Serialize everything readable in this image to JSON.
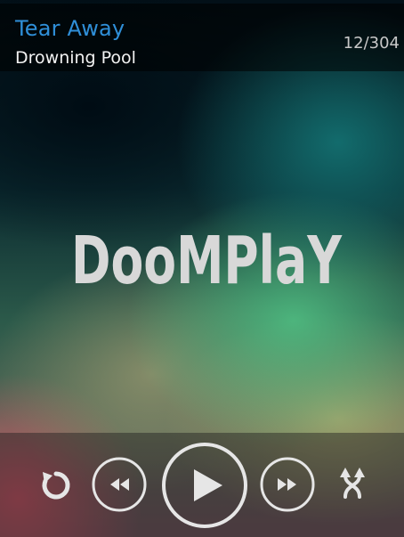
{
  "track": {
    "title": "Tear Away",
    "artist": "Drowning Pool",
    "position": "12/304"
  },
  "artwork": {
    "logo_text": "DooMPlaY"
  },
  "controls": {
    "icons": [
      "repeat-icon",
      "rewind-icon",
      "play-icon",
      "fast-forward-icon",
      "shuffle-icon"
    ]
  },
  "colors": {
    "title": "#2f8fd8",
    "artist": "#f2f2f2",
    "counter": "#c8c8c8",
    "icons": "#e6e6e6"
  }
}
